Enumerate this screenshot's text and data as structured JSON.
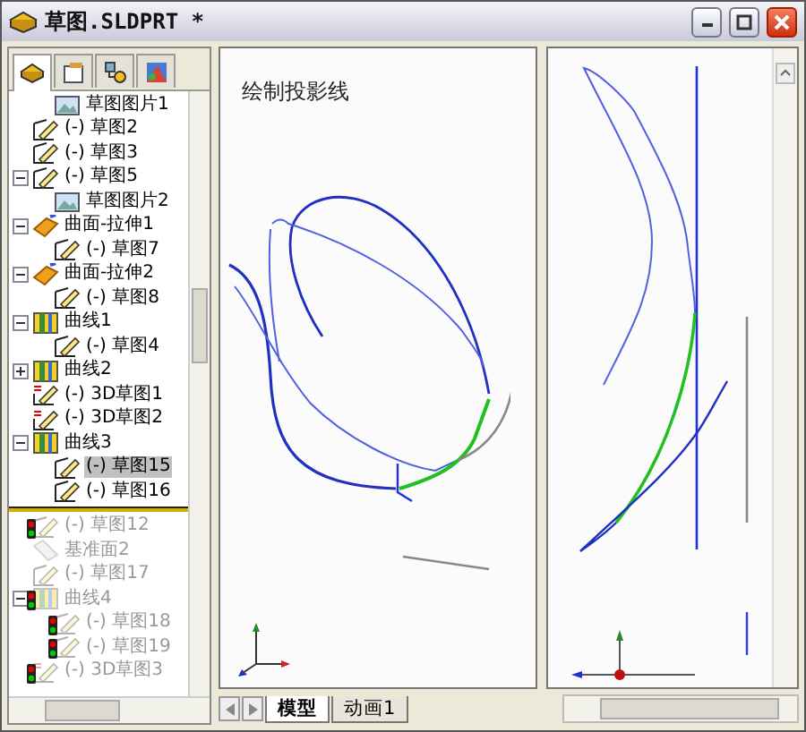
{
  "window": {
    "title": "草图.SLDPRT *"
  },
  "panel_tabs": [
    {
      "kind": "features",
      "selected": true
    },
    {
      "kind": "properties",
      "selected": false
    },
    {
      "kind": "configurations",
      "selected": false
    },
    {
      "kind": "display",
      "selected": false
    }
  ],
  "tree": [
    {
      "kind": "continuation",
      "children": [
        {
          "kind": "picture",
          "label": "草图图片1",
          "selected": false,
          "suppressed": false,
          "warning": false
        }
      ]
    },
    {
      "kind": "sketch",
      "label": "(-) 草图2",
      "selected": false,
      "suppressed": false,
      "warning": false
    },
    {
      "kind": "sketch",
      "label": "(-) 草图3",
      "selected": false,
      "suppressed": false,
      "warning": false
    },
    {
      "kind": "sketch",
      "label": "(-) 草图5",
      "selected": false,
      "suppressed": false,
      "warning": false,
      "expanded": true,
      "children": [
        {
          "kind": "picture",
          "label": "草图图片2",
          "selected": false,
          "suppressed": false,
          "warning": false
        }
      ]
    },
    {
      "kind": "surface",
      "label": "曲面-拉伸1",
      "selected": false,
      "suppressed": false,
      "warning": false,
      "expanded": true,
      "children": [
        {
          "kind": "sketch",
          "label": "(-) 草图7",
          "selected": false,
          "suppressed": false,
          "warning": false
        }
      ]
    },
    {
      "kind": "surface",
      "label": "曲面-拉伸2",
      "selected": false,
      "suppressed": false,
      "warning": false,
      "expanded": true,
      "children": [
        {
          "kind": "sketch",
          "label": "(-) 草图8",
          "selected": false,
          "suppressed": false,
          "warning": false
        }
      ]
    },
    {
      "kind": "curve",
      "label": "曲线1",
      "selected": false,
      "suppressed": false,
      "warning": false,
      "expanded": true,
      "children": [
        {
          "kind": "sketch",
          "label": "(-) 草图4",
          "selected": false,
          "suppressed": false,
          "warning": false
        }
      ]
    },
    {
      "kind": "curve",
      "label": "曲线2",
      "selected": false,
      "suppressed": false,
      "warning": false,
      "expanded": false
    },
    {
      "kind": "sketch3d",
      "label": "(-) 3D草图1",
      "selected": false,
      "suppressed": false,
      "warning": false
    },
    {
      "kind": "sketch3d",
      "label": "(-) 3D草图2",
      "selected": false,
      "suppressed": false,
      "warning": false
    },
    {
      "kind": "curve",
      "label": "曲线3",
      "selected": false,
      "suppressed": false,
      "warning": false,
      "expanded": true,
      "children": [
        {
          "kind": "sketch",
          "label": "(-) 草图15",
          "selected": true,
          "suppressed": false,
          "warning": false
        },
        {
          "kind": "sketch",
          "label": "(-) 草图16",
          "selected": false,
          "suppressed": false,
          "warning": false
        }
      ]
    },
    {
      "kind": "rollback"
    },
    {
      "kind": "sketch",
      "label": "(-) 草图12",
      "selected": false,
      "suppressed": true,
      "warning": true
    },
    {
      "kind": "plane",
      "label": "基准面2",
      "selected": false,
      "suppressed": true,
      "warning": false
    },
    {
      "kind": "sketch",
      "label": "(-) 草图17",
      "selected": false,
      "suppressed": true,
      "warning": false
    },
    {
      "kind": "curve",
      "label": "曲线4",
      "selected": false,
      "suppressed": true,
      "warning": true,
      "expanded": true,
      "children": [
        {
          "kind": "sketch",
          "label": "(-) 草图18",
          "selected": false,
          "suppressed": true,
          "warning": true
        },
        {
          "kind": "sketch",
          "label": "(-) 草图19",
          "selected": false,
          "suppressed": true,
          "warning": true
        }
      ]
    },
    {
      "kind": "sketch3d",
      "label": "(-) 3D草图3",
      "selected": false,
      "suppressed": true,
      "warning": true
    }
  ],
  "view_caption": "绘制投影线",
  "view_tabs": [
    {
      "label": "模型",
      "selected": true
    },
    {
      "label": "动画1",
      "selected": false
    }
  ]
}
